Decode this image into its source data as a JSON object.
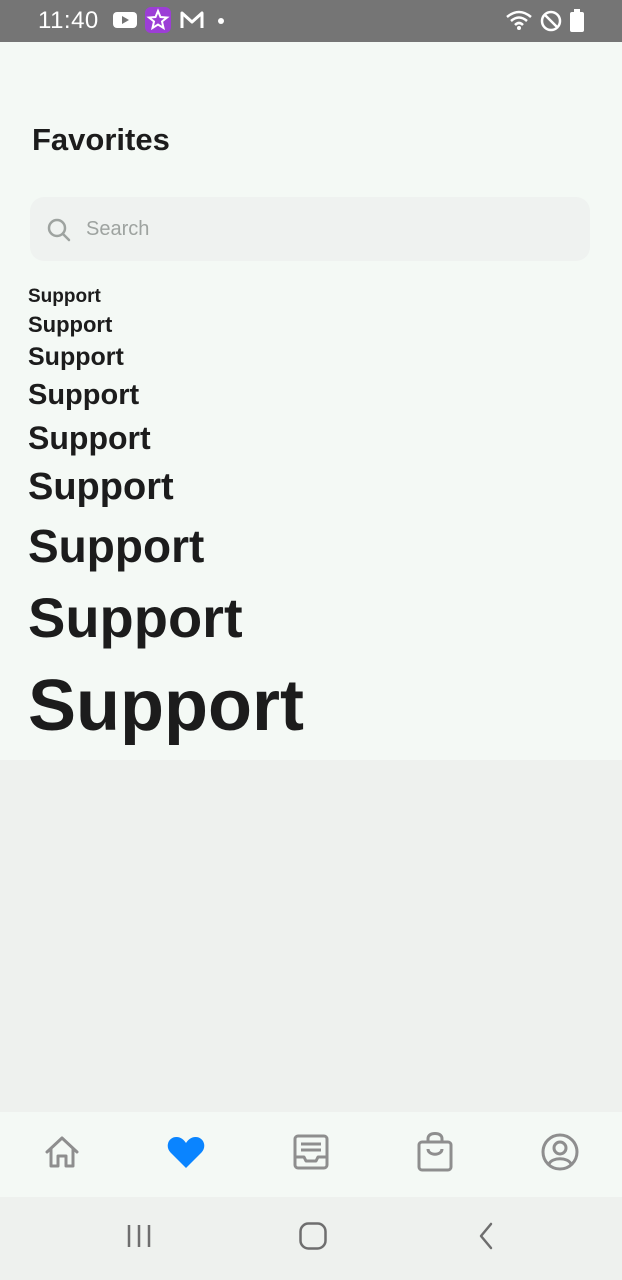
{
  "status_bar": {
    "time": "11:40",
    "left_icons": [
      "youtube-icon",
      "star-app-icon",
      "m-app-icon",
      "notification-dot-icon"
    ],
    "right_icons": [
      "wifi-icon",
      "do-not-disturb-icon",
      "battery-icon"
    ]
  },
  "page": {
    "title": "Favorites"
  },
  "search": {
    "placeholder": "Search",
    "icon": "search-icon"
  },
  "support_items": [
    "Support",
    "Support",
    "Support",
    "Support",
    "Support",
    "Support",
    "Support",
    "Support",
    "Support"
  ],
  "tab_bar": {
    "tabs": [
      {
        "icon": "home-icon",
        "active": false
      },
      {
        "icon": "heart-icon",
        "active": true
      },
      {
        "icon": "orders-icon",
        "active": false
      },
      {
        "icon": "shopping-bag-icon",
        "active": false
      },
      {
        "icon": "account-icon",
        "active": false
      }
    ],
    "active_color": "#0a84ff",
    "inactive_color": "#8e8e8e"
  },
  "nav_bar": {
    "buttons": [
      "recent-apps-icon",
      "home-button-icon",
      "back-icon"
    ]
  }
}
